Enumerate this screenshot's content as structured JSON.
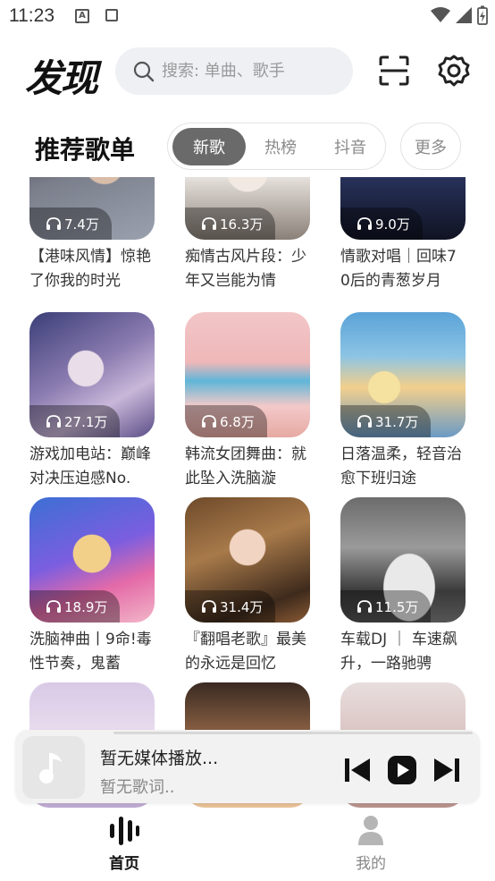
{
  "status_bar": {
    "time": "11:23",
    "a_icon_letter": "A"
  },
  "header": {
    "title": "发现",
    "search_placeholder": "搜索: 单曲、歌手"
  },
  "section": {
    "title": "推荐歌单",
    "tabs": [
      "新歌",
      "热榜",
      "抖音"
    ],
    "active_tab": 0,
    "more_label": "更多"
  },
  "playlists": [
    {
      "count": "7.4万",
      "title": "【港味风情】惊艳了你我的时光",
      "cover": "portrait-dark-hair"
    },
    {
      "count": "16.3万",
      "title": "痴情古风片段：少年又岂能为情",
      "cover": "anime-white-hair"
    },
    {
      "count": "9.0万",
      "title": "情歌对唱｜回味70后的青葱岁月",
      "cover": "duet-singers"
    },
    {
      "count": "27.1万",
      "title": "游戏加电站：巅峰对决压迫感No.",
      "cover": "fantasy-warrior"
    },
    {
      "count": "6.8万",
      "title": "韩流女团舞曲：就此坠入洗脑漩",
      "cover": "girl-group"
    },
    {
      "count": "31.7万",
      "title": "日落温柔，轻音治愈下班归途",
      "cover": "sunset-sky"
    },
    {
      "count": "18.9万",
      "title": "洗脑神曲丨9命!毒性节奏，鬼蓄",
      "cover": "cartoon-hearts"
    },
    {
      "count": "31.4万",
      "title": "『翻唱老歌』最美的永远是回忆",
      "cover": "woman-autumn"
    },
    {
      "count": "11.5万",
      "title": "车载DJ ｜ 车速飙升，一路驰骋",
      "cover": "white-sports-car"
    },
    {
      "count": "",
      "title": "",
      "cover": "anime-lavender"
    },
    {
      "count": "",
      "title": "",
      "cover": "portrait-glow"
    },
    {
      "count": "",
      "title": "",
      "cover": "ancient-costume"
    }
  ],
  "player": {
    "title": "暂无媒体播放...",
    "lyric": "暂无歌词.."
  },
  "nav": [
    {
      "label": "首页",
      "active": true
    },
    {
      "label": "我的",
      "active": false
    }
  ],
  "colors": {
    "accent": "#6a6a6a",
    "search_bg": "#eef0f4",
    "text": "#222222",
    "muted": "#8a8a8a"
  }
}
